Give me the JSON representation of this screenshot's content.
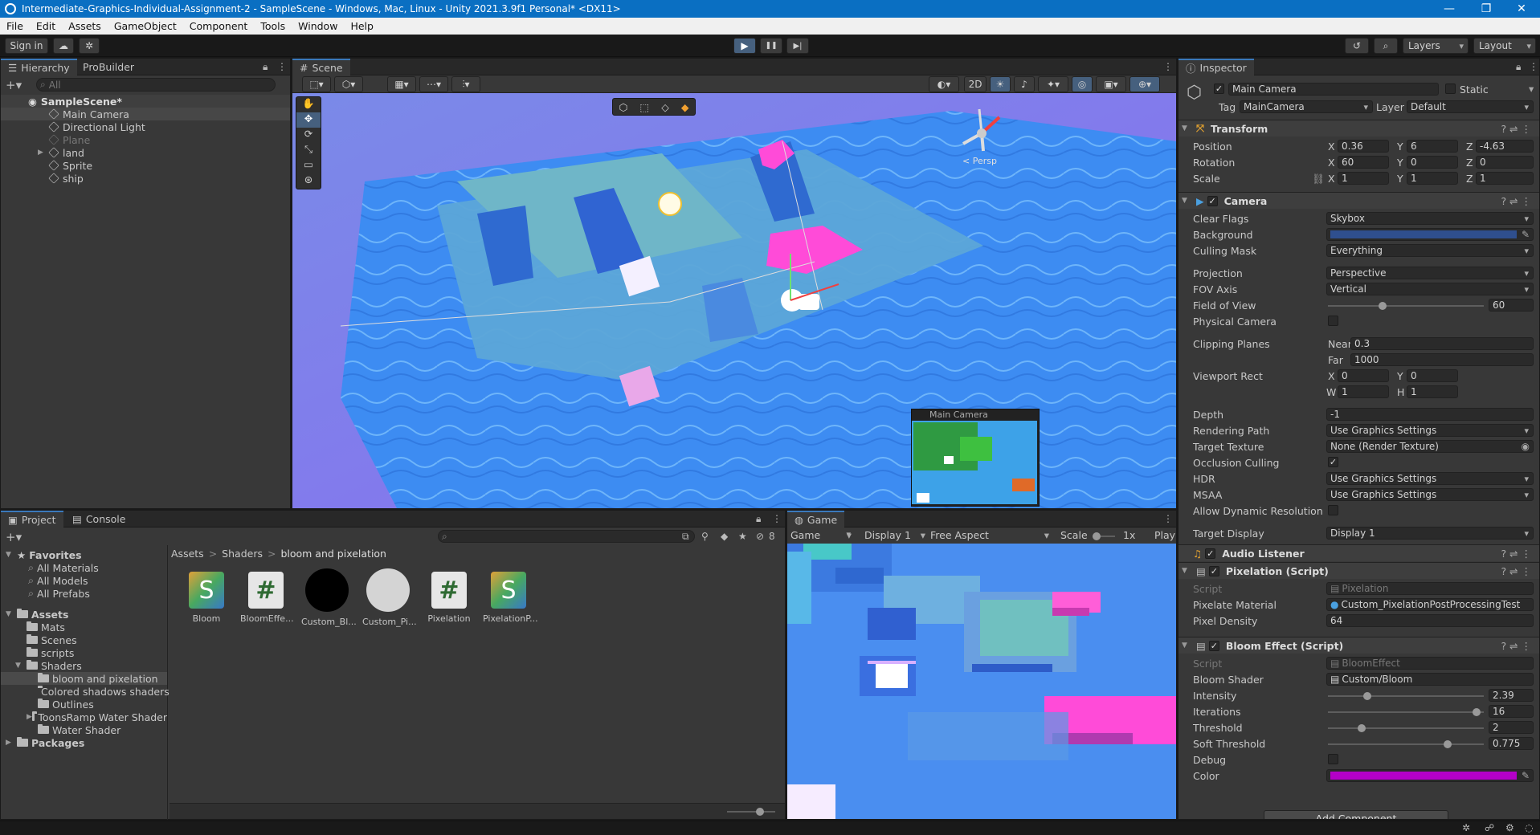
{
  "window": {
    "title": "Intermediate-Graphics-Individual-Assignment-2 - SampleScene - Windows, Mac, Linux - Unity 2021.3.9f1 Personal* <DX11>",
    "min": "—",
    "max": "❐",
    "close": "✕"
  },
  "menu": [
    "File",
    "Edit",
    "Assets",
    "GameObject",
    "Component",
    "Tools",
    "Window",
    "Help"
  ],
  "toolbar": {
    "sign_in": "Sign in",
    "layers": "Layers",
    "layout": "Layout",
    "play": "▶",
    "pause": "❚❚",
    "step": "▶|"
  },
  "hierarchy": {
    "tab_hierarchy": "Hierarchy",
    "tab_probuilder": "ProBuilder",
    "search_placeholder": "All",
    "scene": "SampleScene*",
    "items": [
      "Main Camera",
      "Directional Light",
      "Plane",
      "land",
      "Sprite",
      "ship"
    ]
  },
  "scene": {
    "tab": "Scene",
    "persp": "< Persp",
    "mode_2d": "2D",
    "camera_preview_title": "Main Camera"
  },
  "project": {
    "tab_project": "Project",
    "tab_console": "Console",
    "hidden_count": "8",
    "favorites_label": "Favorites",
    "favorites": [
      "All Materials",
      "All Models",
      "All Prefabs"
    ],
    "assets_label": "Assets",
    "folders": [
      "Mats",
      "Scenes",
      "scripts",
      "Shaders"
    ],
    "shader_folders": [
      "bloom and pixelation",
      "Colored shadows shaders",
      "Outlines",
      "ToonsRamp Water Shader",
      "Water Shader"
    ],
    "packages_label": "Packages",
    "breadcrumb": [
      "Assets",
      "Shaders",
      "bloom and pixelation"
    ],
    "assets": [
      {
        "name": "Bloom",
        "kind": "shader",
        "glyph": "S"
      },
      {
        "name": "BloomEffe...",
        "kind": "script",
        "glyph": "#"
      },
      {
        "name": "Custom_Bl...",
        "kind": "material-black",
        "glyph": ""
      },
      {
        "name": "Custom_Pi...",
        "kind": "material-white",
        "glyph": ""
      },
      {
        "name": "Pixelation",
        "kind": "script",
        "glyph": "#"
      },
      {
        "name": "PixelationP...",
        "kind": "shader",
        "glyph": "S"
      }
    ]
  },
  "game": {
    "tab": "Game",
    "mode": "Game",
    "display": "Display 1",
    "aspect": "Free Aspect",
    "scale_label": "Scale",
    "scale_value": "1x",
    "play_label": "Play"
  },
  "inspector": {
    "tab": "Inspector",
    "object_name": "Main Camera",
    "static_label": "Static",
    "tag_label": "Tag",
    "tag_value": "MainCamera",
    "layer_label": "Layer",
    "layer_value": "Default",
    "transform": {
      "title": "Transform",
      "position_label": "Position",
      "position": [
        "0.36",
        "6",
        "-4.63"
      ],
      "rotation_label": "Rotation",
      "rotation": [
        "60",
        "0",
        "0"
      ],
      "scale_label": "Scale",
      "scale": [
        "1",
        "1",
        "1"
      ]
    },
    "camera": {
      "title": "Camera",
      "clear_flags_label": "Clear Flags",
      "clear_flags": "Skybox",
      "background_label": "Background",
      "background_color": "#2f4f8e",
      "culling_mask_label": "Culling Mask",
      "culling_mask": "Everything",
      "projection_label": "Projection",
      "projection": "Perspective",
      "fov_axis_label": "FOV Axis",
      "fov_axis": "Vertical",
      "fov_label": "Field of View",
      "fov": "60",
      "fov_fraction": 0.34,
      "physical_label": "Physical Camera",
      "clipping_label": "Clipping Planes",
      "near_label": "Near",
      "near": "0.3",
      "far_label": "Far",
      "far": "1000",
      "viewport_label": "Viewport Rect",
      "vx": "0",
      "vy": "0",
      "vw": "1",
      "vh": "1",
      "depth_label": "Depth",
      "depth": "-1",
      "rendering_path_label": "Rendering Path",
      "rendering_path": "Use Graphics Settings",
      "target_texture_label": "Target Texture",
      "target_texture": "None (Render Texture)",
      "occlusion_label": "Occlusion Culling",
      "hdr_label": "HDR",
      "hdr": "Use Graphics Settings",
      "msaa_label": "MSAA",
      "msaa": "Use Graphics Settings",
      "dynres_label": "Allow Dynamic Resolution",
      "target_display_label": "Target Display",
      "target_display": "Display 1"
    },
    "audio_listener": "Audio Listener",
    "pixelation": {
      "title": "Pixelation (Script)",
      "script_label": "Script",
      "script": "Pixelation",
      "material_label": "Pixelate Material",
      "material": "Custom_PixelationPostProcessingTest",
      "density_label": "Pixel Density",
      "density": "64"
    },
    "bloom": {
      "title": "Bloom Effect (Script)",
      "script_label": "Script",
      "script": "BloomEffect",
      "shader_label": "Bloom Shader",
      "shader": "Custom/Bloom",
      "intensity_label": "Intensity",
      "intensity": "2.39",
      "intensity_fraction": 0.24,
      "iterations_label": "Iterations",
      "iterations": "16",
      "iterations_fraction": 0.98,
      "threshold_label": "Threshold",
      "threshold": "2",
      "threshold_fraction": 0.2,
      "soft_label": "Soft Threshold",
      "soft": "0.775",
      "soft_fraction": 0.78,
      "debug_label": "Debug",
      "color_label": "Color",
      "color": "#b400c8"
    },
    "add_component": "Add Component"
  }
}
